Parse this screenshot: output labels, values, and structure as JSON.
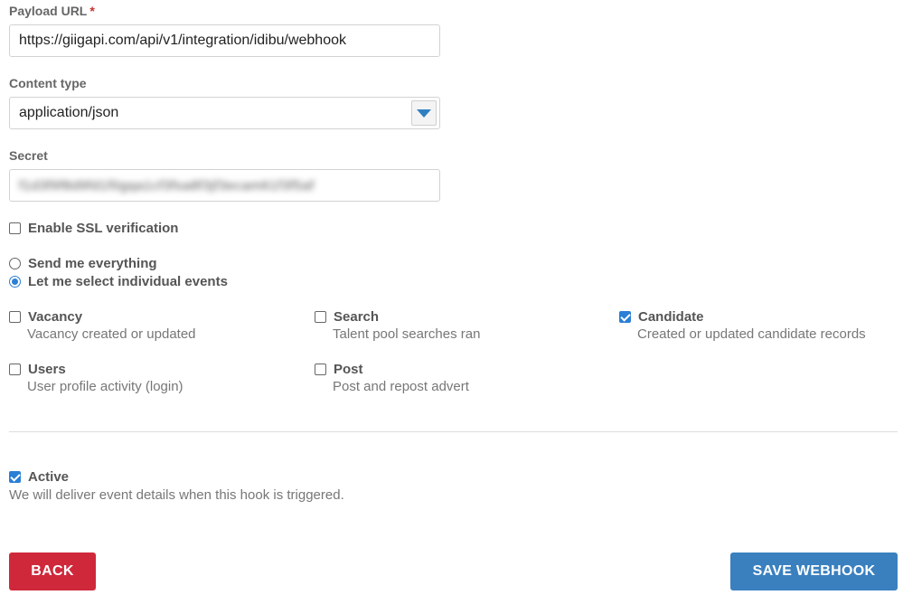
{
  "form": {
    "payload_url": {
      "label": "Payload URL",
      "required_mark": "*",
      "value": "https://giigapi.com/api/v1/integration/idibu/webhook"
    },
    "content_type": {
      "label": "Content type",
      "selected": "application/json"
    },
    "secret": {
      "label": "Secret",
      "value": "f1d3f9f8d9fd1f0gqa1cf3fsa8f3jf3ecam61f3f5af"
    },
    "ssl": {
      "label": "Enable SSL verification",
      "checked": false
    },
    "trigger": {
      "options": [
        {
          "label": "Send me everything",
          "checked": false
        },
        {
          "label": "Let me select individual events",
          "checked": true
        }
      ]
    },
    "events": [
      {
        "title": "Vacancy",
        "desc": "Vacancy created or updated",
        "checked": false
      },
      {
        "title": "Search",
        "desc": "Talent pool searches ran",
        "checked": false
      },
      {
        "title": "Candidate",
        "desc": "Created or updated candidate records",
        "checked": true
      },
      {
        "title": "Users",
        "desc": "User profile activity (login)",
        "checked": false
      },
      {
        "title": "Post",
        "desc": "Post and repost advert",
        "checked": false
      }
    ],
    "active": {
      "label": "Active",
      "desc": "We will deliver event details when this hook is triggered.",
      "checked": true
    }
  },
  "buttons": {
    "back": "BACK",
    "save": "SAVE WEBHOOK"
  },
  "colors": {
    "back": "#d0283b",
    "save": "#3a80bf",
    "accent": "#2b7fd4"
  }
}
